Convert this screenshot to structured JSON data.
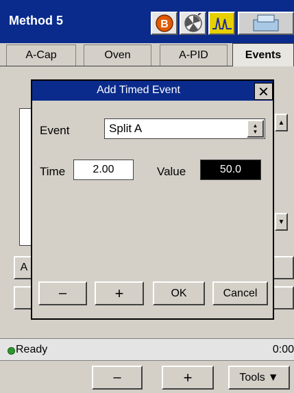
{
  "window": {
    "title": "Method 5"
  },
  "titlebar_icons": [
    {
      "name": "b-status-icon",
      "letter": "B",
      "color": "#e05a00"
    },
    {
      "name": "fan-icon"
    },
    {
      "name": "chromatogram-icon",
      "color": "#e6d000"
    },
    {
      "name": "vial-tray-icon"
    }
  ],
  "tabs": [
    {
      "label": "A-Cap",
      "active": false
    },
    {
      "label": "Oven",
      "active": false
    },
    {
      "label": "A-PID",
      "active": false
    },
    {
      "label": "Events",
      "active": true
    }
  ],
  "background": {
    "left_button_1": "A"
  },
  "dialog": {
    "title": "Add Timed Event",
    "close_glyph": "✕",
    "event_label": "Event",
    "event_value": "Split A",
    "time_label": "Time",
    "time_value": "2.00",
    "value_label": "Value",
    "value_value": "50.0",
    "minus_label": "–",
    "plus_label": "+",
    "ok_label": "OK",
    "cancel_label": "Cancel"
  },
  "status": {
    "text": "Ready",
    "time": "0:00",
    "indicator_color": "#2a9a2a"
  },
  "toolbar": {
    "minus_label": "–",
    "plus_label": "+",
    "tools_label": "Tools",
    "tools_arrow": "▼"
  }
}
